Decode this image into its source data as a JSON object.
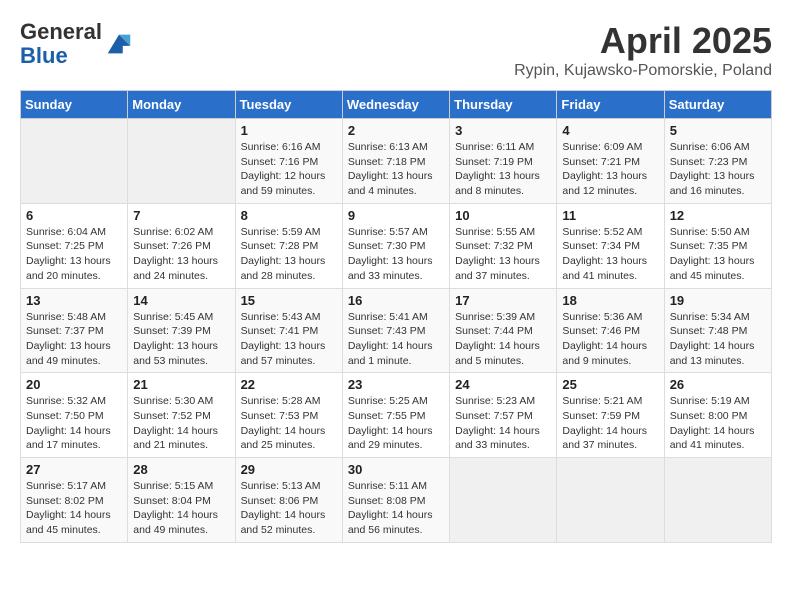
{
  "header": {
    "logo_line1": "General",
    "logo_line2": "Blue",
    "title": "April 2025",
    "subtitle": "Rypin, Kujawsko-Pomorskie, Poland"
  },
  "weekdays": [
    "Sunday",
    "Monday",
    "Tuesday",
    "Wednesday",
    "Thursday",
    "Friday",
    "Saturday"
  ],
  "weeks": [
    [
      {
        "day": "",
        "info": ""
      },
      {
        "day": "",
        "info": ""
      },
      {
        "day": "1",
        "info": "Sunrise: 6:16 AM\nSunset: 7:16 PM\nDaylight: 12 hours\nand 59 minutes."
      },
      {
        "day": "2",
        "info": "Sunrise: 6:13 AM\nSunset: 7:18 PM\nDaylight: 13 hours\nand 4 minutes."
      },
      {
        "day": "3",
        "info": "Sunrise: 6:11 AM\nSunset: 7:19 PM\nDaylight: 13 hours\nand 8 minutes."
      },
      {
        "day": "4",
        "info": "Sunrise: 6:09 AM\nSunset: 7:21 PM\nDaylight: 13 hours\nand 12 minutes."
      },
      {
        "day": "5",
        "info": "Sunrise: 6:06 AM\nSunset: 7:23 PM\nDaylight: 13 hours\nand 16 minutes."
      }
    ],
    [
      {
        "day": "6",
        "info": "Sunrise: 6:04 AM\nSunset: 7:25 PM\nDaylight: 13 hours\nand 20 minutes."
      },
      {
        "day": "7",
        "info": "Sunrise: 6:02 AM\nSunset: 7:26 PM\nDaylight: 13 hours\nand 24 minutes."
      },
      {
        "day": "8",
        "info": "Sunrise: 5:59 AM\nSunset: 7:28 PM\nDaylight: 13 hours\nand 28 minutes."
      },
      {
        "day": "9",
        "info": "Sunrise: 5:57 AM\nSunset: 7:30 PM\nDaylight: 13 hours\nand 33 minutes."
      },
      {
        "day": "10",
        "info": "Sunrise: 5:55 AM\nSunset: 7:32 PM\nDaylight: 13 hours\nand 37 minutes."
      },
      {
        "day": "11",
        "info": "Sunrise: 5:52 AM\nSunset: 7:34 PM\nDaylight: 13 hours\nand 41 minutes."
      },
      {
        "day": "12",
        "info": "Sunrise: 5:50 AM\nSunset: 7:35 PM\nDaylight: 13 hours\nand 45 minutes."
      }
    ],
    [
      {
        "day": "13",
        "info": "Sunrise: 5:48 AM\nSunset: 7:37 PM\nDaylight: 13 hours\nand 49 minutes."
      },
      {
        "day": "14",
        "info": "Sunrise: 5:45 AM\nSunset: 7:39 PM\nDaylight: 13 hours\nand 53 minutes."
      },
      {
        "day": "15",
        "info": "Sunrise: 5:43 AM\nSunset: 7:41 PM\nDaylight: 13 hours\nand 57 minutes."
      },
      {
        "day": "16",
        "info": "Sunrise: 5:41 AM\nSunset: 7:43 PM\nDaylight: 14 hours\nand 1 minute."
      },
      {
        "day": "17",
        "info": "Sunrise: 5:39 AM\nSunset: 7:44 PM\nDaylight: 14 hours\nand 5 minutes."
      },
      {
        "day": "18",
        "info": "Sunrise: 5:36 AM\nSunset: 7:46 PM\nDaylight: 14 hours\nand 9 minutes."
      },
      {
        "day": "19",
        "info": "Sunrise: 5:34 AM\nSunset: 7:48 PM\nDaylight: 14 hours\nand 13 minutes."
      }
    ],
    [
      {
        "day": "20",
        "info": "Sunrise: 5:32 AM\nSunset: 7:50 PM\nDaylight: 14 hours\nand 17 minutes."
      },
      {
        "day": "21",
        "info": "Sunrise: 5:30 AM\nSunset: 7:52 PM\nDaylight: 14 hours\nand 21 minutes."
      },
      {
        "day": "22",
        "info": "Sunrise: 5:28 AM\nSunset: 7:53 PM\nDaylight: 14 hours\nand 25 minutes."
      },
      {
        "day": "23",
        "info": "Sunrise: 5:25 AM\nSunset: 7:55 PM\nDaylight: 14 hours\nand 29 minutes."
      },
      {
        "day": "24",
        "info": "Sunrise: 5:23 AM\nSunset: 7:57 PM\nDaylight: 14 hours\nand 33 minutes."
      },
      {
        "day": "25",
        "info": "Sunrise: 5:21 AM\nSunset: 7:59 PM\nDaylight: 14 hours\nand 37 minutes."
      },
      {
        "day": "26",
        "info": "Sunrise: 5:19 AM\nSunset: 8:00 PM\nDaylight: 14 hours\nand 41 minutes."
      }
    ],
    [
      {
        "day": "27",
        "info": "Sunrise: 5:17 AM\nSunset: 8:02 PM\nDaylight: 14 hours\nand 45 minutes."
      },
      {
        "day": "28",
        "info": "Sunrise: 5:15 AM\nSunset: 8:04 PM\nDaylight: 14 hours\nand 49 minutes."
      },
      {
        "day": "29",
        "info": "Sunrise: 5:13 AM\nSunset: 8:06 PM\nDaylight: 14 hours\nand 52 minutes."
      },
      {
        "day": "30",
        "info": "Sunrise: 5:11 AM\nSunset: 8:08 PM\nDaylight: 14 hours\nand 56 minutes."
      },
      {
        "day": "",
        "info": ""
      },
      {
        "day": "",
        "info": ""
      },
      {
        "day": "",
        "info": ""
      }
    ]
  ]
}
